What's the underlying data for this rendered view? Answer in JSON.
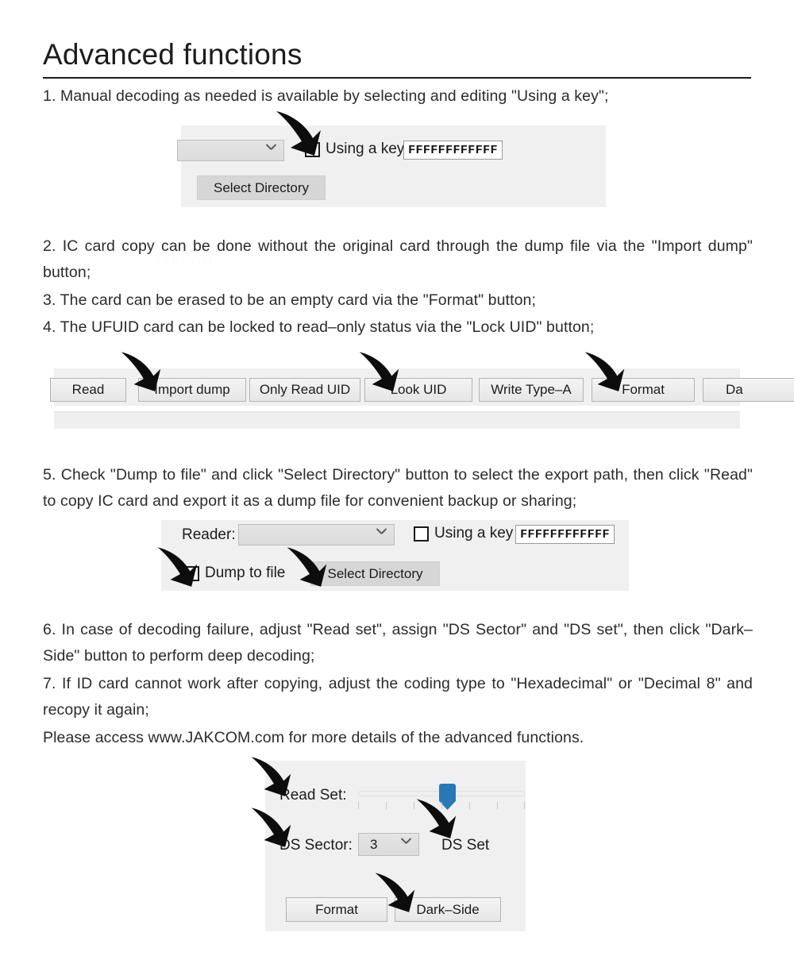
{
  "document": {
    "title": "Advanced functions",
    "paragraphs": [
      "1. Manual decoding as needed is available by selecting and editing \"Using a key\";",
      "2. IC card copy can be done without the original card through the dump file via the \"Import dump\" button;",
      "3. The card can be erased to be an empty card via the \"Format\" button;",
      "4. The UFUID card can be locked to read–only status via the \"Lock UID\" button;",
      "5. Check \"Dump to file\" and click \"Select Directory\" button to select the export path, then click \"Read\" to copy IC card and export it as a dump file for convenient backup or sharing;",
      "6. In case of decoding failure, adjust \"Read set\", assign \"DS Sector\" and \"DS set\", then click \"Dark–Side\" button to perform deep decoding;",
      "7. If ID card cannot work after copying, adjust the coding type to \"Hexadecimal\" or \"Decimal 8\" and recopy it again;",
      "Please access www.JAKCOM.com for more details of the advanced functions."
    ],
    "watermark": "JAKCOM"
  },
  "screenshot_key_panel": {
    "reader_combo_value": "",
    "using_key_checkbox_label": "Using a key",
    "key_value": "FFFFFFFFFFFF",
    "select_directory_label": "Select Directory"
  },
  "screenshot_toolbar": {
    "buttons": [
      {
        "label": "Read"
      },
      {
        "label": "Import dump"
      },
      {
        "label": "Only Read UID"
      },
      {
        "label": "Look UID"
      },
      {
        "label": "Write Type–A"
      },
      {
        "label": "Format"
      },
      {
        "label": "Da"
      }
    ]
  },
  "screenshot_dump_panel": {
    "reader_label": "Reader:",
    "reader_combo_value": "",
    "using_key_checkbox_label": "Using a key",
    "key_value": "FFFFFFFFFFFF",
    "dump_to_file_label": "Dump to file",
    "select_directory_label": "Select Directory"
  },
  "screenshot_darkside_panel": {
    "read_set_label": "Read Set:",
    "read_set_slider_percent": 50,
    "ds_sector_label": "DS Sector:",
    "ds_sector_value": "3",
    "ds_set_label": "DS Set",
    "format_label": "Format",
    "dark_side_label": "Dark–Side"
  },
  "colors": {
    "panel_background": "#f0f0f0",
    "slider_thumb": "#2a77b5",
    "text": "#2b2b2b",
    "rule": "#1c1c1c"
  }
}
